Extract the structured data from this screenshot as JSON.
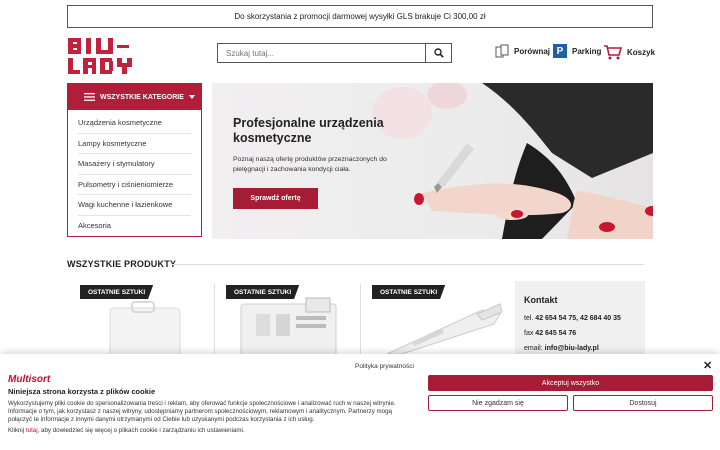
{
  "promo_text": "Do skorzystania z promocji darmowej wysyłki GLS brakuje Ci 300,00 zł",
  "search": {
    "placeholder": "Szukaj tutaj..."
  },
  "header": {
    "compare_label": "Porównaj",
    "parking_label": "Parking",
    "cart_label": "Koszyk"
  },
  "categories": {
    "heading": "WSZYSTKIE KATEGORIE",
    "items": [
      "Urządzenia kosmetyczne",
      "Lampy kosmetyczne",
      "Masażery i stymulatory",
      "Pulsometry i ciśnieniomierze",
      "Wagi kuchenne i łazienkowe",
      "Akcesoria"
    ]
  },
  "hero": {
    "title": "Profesjonalne urządzenia kosmetyczne",
    "text": "Poznaj naszą ofertę produktów przeznaczonych do pielęgnacji i zachowania kondycji ciała.",
    "cta": "Sprawdź ofertę"
  },
  "products_section": {
    "title": "WSZYSTKIE PRODUKTY",
    "badges": [
      "OSTATNIE SZTUKI",
      "OSTATNIE SZTUKI",
      "OSTATNIE SZTUKI"
    ]
  },
  "contact": {
    "title": "Kontakt",
    "tel_label": "tel.",
    "tel": "42 654 54 75, 42 684 40 35",
    "fax_label": "fax",
    "fax": "42 645 54 76",
    "email_label": "email:",
    "email": "info@biu-lady.pl"
  },
  "cookie": {
    "brand": "Multisort",
    "policy_link": "Polityka prywatności",
    "title": "Niniejsza strona korzysta z plików cookie",
    "text": "Wykorzystujemy pliki cookie do spersonalizowania treści i reklam, aby oferować funkcje społecznościowe i analizować ruch w naszej witrynie. Informacje o tym, jak korzystasz z naszej witryny, udostępniamy partnerom społecznościowym, reklamowym i analitycznym. Partnerzy mogą połączyć te informacje z innymi danymi otrzymanymi od Ciebie lub uzyskanymi podczas korzystania z ich usług.",
    "more_prefix": "Kliknij",
    "more_link": "tutaj",
    "more_suffix": ", aby dowiedzieć się więcej o plikach cookie i zarządzaniu ich ustawieniami.",
    "accept_all": "Akceptuj wszystko",
    "reject": "Nie zgadzam się",
    "customize": "Dostosuj"
  },
  "colors": {
    "brand": "#b01e3a",
    "button": "#a61c34"
  }
}
